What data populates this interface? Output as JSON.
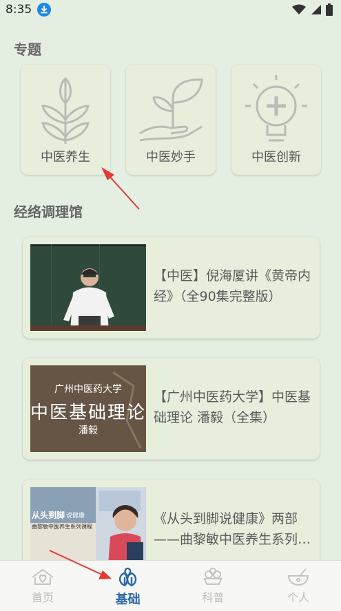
{
  "status_bar": {
    "time": "8:35"
  },
  "topics": {
    "title": "专题",
    "items": [
      {
        "label": "中医养生",
        "icon": "wheat-icon"
      },
      {
        "label": "中医妙手",
        "icon": "hand-sprout-icon"
      },
      {
        "label": "中医创新",
        "icon": "lightbulb-cross-icon"
      }
    ]
  },
  "hall": {
    "title": "经络调理馆",
    "courses": [
      {
        "title": "【中医】倪海厦讲《黄帝内经》（全90集完整版）"
      },
      {
        "title": "【广州中医药大学】中医基础理论 潘毅（全集）",
        "thumb_line1": "广州中医药大学",
        "thumb_line2": "中医基础理论",
        "thumb_line3": "潘毅"
      },
      {
        "title": "《从头到脚说健康》两部——曲黎敏中医养生系列课程",
        "thumb_line1": "从头到脚",
        "thumb_line2": "说健康",
        "thumb_line3": "曲黎敏中医养生系列课程"
      }
    ]
  },
  "nav": {
    "items": [
      {
        "label": "首页",
        "active": false
      },
      {
        "label": "基础",
        "active": true
      },
      {
        "label": "科普",
        "active": false
      },
      {
        "label": "个人",
        "active": false
      }
    ]
  },
  "colors": {
    "accent": "#2a68a8",
    "background": "#e4efe2",
    "card": "#e8eedc",
    "annotation_arrow": "#e53935"
  }
}
